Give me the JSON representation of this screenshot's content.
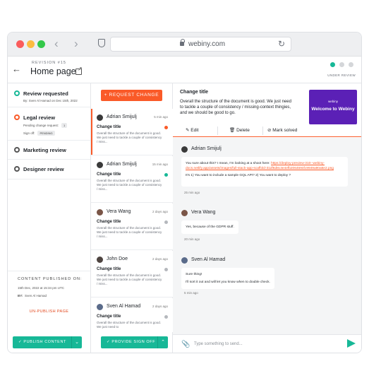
{
  "browser": {
    "url": "webiny.com",
    "dot_colors": [
      "#fa5c5c",
      "#fdbc40",
      "#34c84a"
    ]
  },
  "header": {
    "revision_label": "REVISION #15",
    "title": "Home page",
    "status_label": "UNDER REVIEW"
  },
  "sidebar": {
    "steps": [
      {
        "title": "Review requested",
        "meta": "By:  Sven Al Hamad on Dec 15th, 2022",
        "ring_color": "#17b897"
      },
      {
        "title": "Legal review",
        "pending_label": "Pending change request:",
        "pending_count": "1",
        "signoff_label": "Sign off:",
        "signoff_status": "PENDING",
        "ring_color": "#fa5a28"
      },
      {
        "title": "Marketing review",
        "ring_color": "#555555"
      },
      {
        "title": "Designer review",
        "ring_color": "#555555"
      }
    ],
    "published_label": "CONTENT PUBLISHED ON:",
    "published_date": "15th Dec, 2022 at 15:34 pm UTC",
    "published_by_label": "BY:",
    "published_by": "Sven Al Hamad",
    "unpublish_label": "UN-PUBLISH PAGE",
    "publish_button": "✓  PUBLISH CONTENT"
  },
  "change_requests": {
    "request_button": "+  REQUEST CHANGE",
    "items": [
      {
        "author": "Adrian Smijulj",
        "time": "5 min ago",
        "title": "Change title",
        "body": "Overall the structure of the document is good. We just need to tackle a couple of consistency / miss...",
        "dot_color": "#fa5a28",
        "avatar_color": "#3a3a3a"
      },
      {
        "author": "Adrian Smijulj",
        "time": "15 min ago",
        "title": "Change title",
        "body": "Overall the structure of the document is good. We just need to tackle a couple of consistency / miss...",
        "dot_color": "#17b897",
        "avatar_color": "#3a3a3a"
      },
      {
        "author": "Vera Wang",
        "time": "2 days ago",
        "title": "Change title",
        "body": "Overall the structure of the document is good. We just need to tackle a couple of consistency / miss...",
        "dot_color": "#b5b8bd",
        "avatar_color": "#7a5547"
      },
      {
        "author": "John Doe",
        "time": "2 days ago",
        "title": "Change title",
        "body": "Overall the structure of the document is good. We just need to tackle a couple of consistency / miss...",
        "dot_color": "#b5b8bd",
        "avatar_color": "#4e4440"
      },
      {
        "author": "Sven Al Hamad",
        "time": "2 days ago",
        "title": "Change title",
        "body": "Overall the structure of the document is good. We just need to",
        "dot_color": "#b5b8bd",
        "avatar_color": "#5a6b8a"
      }
    ],
    "signoff_button": "✓  PROVIDE SIGN OFF"
  },
  "detail": {
    "title": "Change title",
    "body": "Overall the structure of the document is good. We just need to tackle a couple of consistency / missing-context thingies, and we should be good to go.",
    "preview_logo": "webiny",
    "preview_title": "Welcome to Webiny",
    "actions": {
      "edit": "Edit",
      "delete": "Delete",
      "resolve": "Mark solved"
    }
  },
  "thread": [
    {
      "author": "Adrian Smijulj",
      "lines": [
        "You sure about this? I mean, I'm looking at a shoot here:",
        "It's 1) You want to include a sample GQL API? 2) You want to deploy ?"
      ],
      "link": "https://deploy-preview-310--webiny-docs.netlify.app/assets/images/full-stack-app-scaffold-31df6d8c3e4efb2064694fc9949a90a6e2.png",
      "time": "25 min ago",
      "avatar_color": "#3a3a3a"
    },
    {
      "author": "Vera Wang",
      "lines": [
        "Yes, because of the GDPR stuff."
      ],
      "time": "20 min ago",
      "avatar_color": "#7a5547"
    },
    {
      "author": "Sven Al Hamad",
      "lines": [
        "Sure thing!",
        "I'll sort it out and will let you know when to double check."
      ],
      "time": "5 min ago",
      "avatar_color": "#5a6b8a"
    }
  ],
  "composer": {
    "placeholder": "Type something to send..."
  }
}
